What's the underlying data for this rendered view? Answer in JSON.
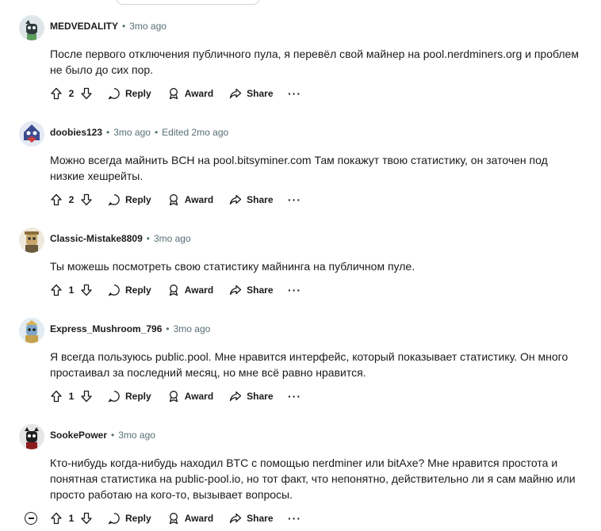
{
  "actions": {
    "reply": "Reply",
    "award": "Award",
    "share": "Share",
    "more": "···"
  },
  "comments": [
    {
      "author": "MEDVEDALITY",
      "time": "3mo ago",
      "edited": "",
      "body": "После первого отключения публичного пула, я перевёл свой майнер на pool.nerdminers.org и проблем не было до сих пор.",
      "votes": "2"
    },
    {
      "author": "doobies123",
      "time": "3mo ago",
      "edited": "Edited 2mo ago",
      "body": "Можно всегда майнить BCH на pool.bitsyminer.com Там покажут твою статистику, он заточен под низкие хешрейты.",
      "votes": "2"
    },
    {
      "author": "Classic-Mistake8809",
      "time": "3mo ago",
      "edited": "",
      "body": "Ты можешь посмотреть свою статистику майнинга на публичном пуле.",
      "votes": "1"
    },
    {
      "author": "Express_Mushroom_796",
      "time": "3mo ago",
      "edited": "",
      "body": "Я всегда пользуюсь public.pool. Мне нравится интерфейс, который показывает статистику. Он много простаивал за последний месяц, но мне всё равно нравится.",
      "votes": "1"
    },
    {
      "author": "SookePower",
      "time": "3mo ago",
      "edited": "",
      "body": "Кто-нибудь когда-нибудь находил BTC с помощью nerdminer или bitAxe? Мне нравится простота и понятная статистика на public-pool.io, но тот факт, что непонятно, действительно ли я сам майню или просто работаю на кого-то, вызывает вопросы.",
      "votes": "1"
    }
  ]
}
